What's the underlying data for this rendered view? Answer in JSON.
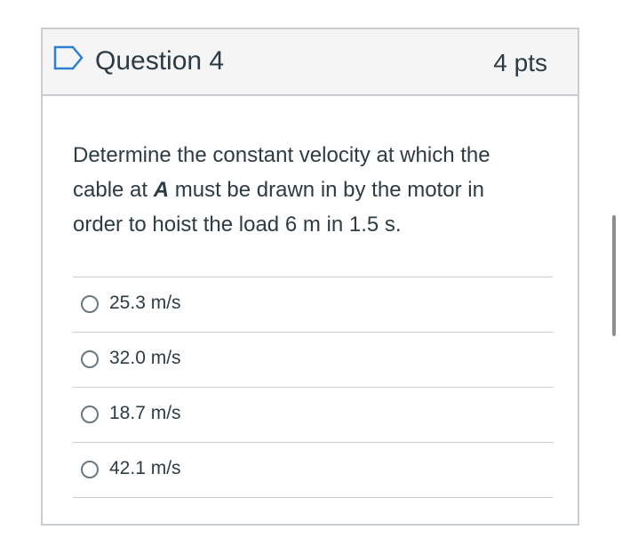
{
  "question": {
    "title": "Question 4",
    "points": "4 pts",
    "text_before": "Determine the constant velocity at which the cable at ",
    "text_bold": "A",
    "text_after": " must be drawn in by the motor in order to hoist the load 6 m in 1.5 s."
  },
  "answers": [
    {
      "label": "25.3 m/s",
      "selected": false
    },
    {
      "label": "32.0 m/s",
      "selected": false
    },
    {
      "label": "18.7 m/s",
      "selected": false
    },
    {
      "label": "42.1 m/s",
      "selected": false
    }
  ],
  "colors": {
    "flag": "#2d7fd1",
    "header_bg": "#f5f5f5",
    "border": "#c7cdd1",
    "text": "#2d3b45"
  }
}
